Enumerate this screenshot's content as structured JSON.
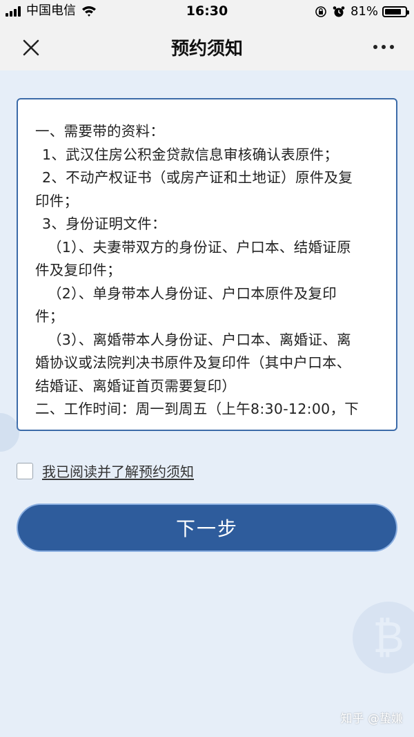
{
  "status_bar": {
    "carrier": "中国电信",
    "time": "16:30",
    "battery_percent": "81%",
    "battery_level": 0.81
  },
  "nav": {
    "title": "预约须知",
    "close_icon": "close-icon",
    "more_icon": "more-icon"
  },
  "notice": {
    "lines": [
      "一、需要带的资料：",
      "1、武汉住房公积金贷款信息审核确认表原件；",
      "2、不动产权证书（或房产证和土地证）原件及复",
      "印件；",
      "3、身份证明文件：",
      "（1）、夫妻带双方的身份证、户口本、结婚证原",
      "件及复印件；",
      "（2）、单身带本人身份证、户口本原件及复印",
      "件；",
      "（3）、离婚带本人身份证、户口本、离婚证、离",
      "婚协议或法院判决书原件及复印件（其中户口本、",
      "结婚证、离婚证首页需要复印）",
      "二、工作时间：周一到周五（上午8:30-12:00，下"
    ]
  },
  "agree": {
    "label": "我已阅读并了解预约须知",
    "checked": false
  },
  "next_button": {
    "label": "下一步"
  },
  "watermark": {
    "text": "知乎 @蛰嫌"
  },
  "colors": {
    "accent": "#2e5c9c",
    "box_border": "#3b6aa8",
    "background": "#e6eef8",
    "header": "#f2f2f2"
  }
}
